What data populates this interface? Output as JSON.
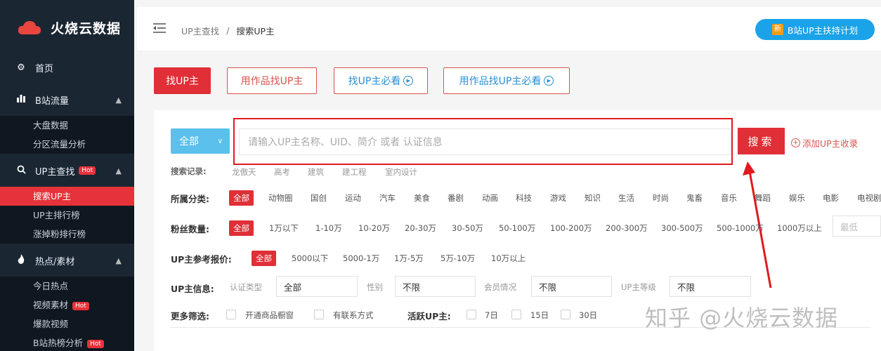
{
  "app": {
    "name": "火烧云数据"
  },
  "sidebar": {
    "home": "首页",
    "groups": [
      {
        "label": "B站流量",
        "items": [
          "大盘数据",
          "分区流量分析"
        ]
      },
      {
        "label": "UP主查找",
        "hot": "Hot",
        "items": [
          "搜索UP主",
          "UP主排行榜",
          "涨掉粉排行榜"
        ]
      },
      {
        "label": "热点/素材",
        "items": [
          "今日热点",
          "视频素材",
          "爆款视频",
          "B站热榜分析"
        ]
      }
    ],
    "hot_badge": "Hot"
  },
  "header": {
    "breadcrumb": [
      "UP主查找",
      "搜索UP主"
    ],
    "separator": "/",
    "plan_button": "B站UP主扶持计划",
    "plan_icon_text": "新"
  },
  "tabs": [
    "找UP主",
    "用作品找UP主",
    "找UP主必看",
    "用作品找UP主必看"
  ],
  "search": {
    "scope": "全部",
    "placeholder": "请输入UP主名称、UID、简介 或者 认证信息",
    "button": "搜索",
    "add_link": "添加UP主收录"
  },
  "history": {
    "label": "搜索记录:",
    "items": [
      "龙傲天",
      "高考",
      "建筑",
      "建工程",
      "室内设计"
    ]
  },
  "category": {
    "label": "所属分类:",
    "options": [
      "全部",
      "动物圈",
      "国创",
      "运动",
      "汽车",
      "美食",
      "番剧",
      "动画",
      "科技",
      "游戏",
      "知识",
      "生活",
      "时尚",
      "鬼畜",
      "音乐",
      "舞蹈",
      "娱乐",
      "电影",
      "电视剧"
    ]
  },
  "fans": {
    "label": "粉丝数量:",
    "options": [
      "全部",
      "1万以下",
      "1-10万",
      "10-20万",
      "20-30万",
      "30-50万",
      "50-100万",
      "100-200万",
      "200-300万",
      "300-500万",
      "500-1000万",
      "1000万以上"
    ],
    "min_placeholder": "最低"
  },
  "price": {
    "label": "UP主参考报价:",
    "options": [
      "全部",
      "5000以下",
      "5000-1万",
      "1万-5万",
      "5万-10万",
      "10万以上"
    ]
  },
  "info": {
    "label": "UP主信息:",
    "fields": [
      {
        "name": "认证类型",
        "value": "全部"
      },
      {
        "name": "性别",
        "value": "不限"
      },
      {
        "name": "会员情况",
        "value": "不限"
      },
      {
        "name": "UP主等级",
        "value": "不限"
      }
    ]
  },
  "more": {
    "label": "更多筛选:",
    "options": [
      "开通商品橱窗",
      "有联系方式"
    ],
    "active_label": "活跃UP主:",
    "active_options": [
      "7日",
      "15日",
      "30日"
    ]
  },
  "watermark": "知乎 @火烧云数据",
  "colors": {
    "accent": "#e02f36",
    "sidebar": "#1b2633",
    "primary_blue": "#1aa3e8"
  }
}
